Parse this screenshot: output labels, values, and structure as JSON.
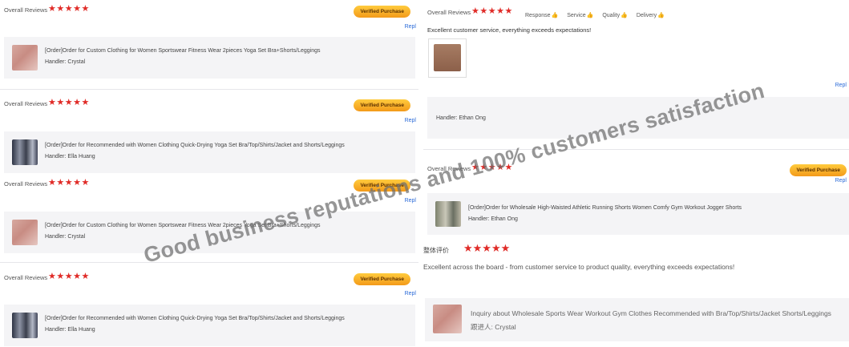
{
  "left_reviews": [
    {
      "label": "Overall Reviews",
      "stars": "★★★★★",
      "badge": "Verified Purchase",
      "reply": "Repl",
      "order_title": "[Order]Order for Custom Clothing for Women Sportswear Fitness Wear 2pieces Yoga Set Bra+Shorts/Leggings",
      "handler": "Handler: Crystal"
    },
    {
      "label": "Overall Reviews",
      "stars": "★★★★★",
      "badge": "Verified Purchase",
      "reply": "Repl",
      "order_title": "[Order]Order for Recommended with Women Clothing Quick-Drying Yoga Set Bra/Top/Shirts/Jacket and Shorts/Leggings",
      "handler": "Handler: Ella Huang"
    },
    {
      "label": "Overall Reviews",
      "stars": "★★★★★",
      "badge": "Verified Purchase",
      "reply": "Repl",
      "order_title": "[Order]Order for Custom Clothing for Women Sportswear Fitness Wear 2pieces Yoga Set Bra+Shorts/Leggings",
      "handler": "Handler: Crystal"
    },
    {
      "label": "Overall Reviews",
      "stars": "★★★★★",
      "badge": "Verified Purchase",
      "reply": "Repl",
      "order_title": "[Order]Order for Recommended with Women Clothing Quick-Drying Yoga Set Bra/Top/Shirts/Jacket and Shorts/Leggings",
      "handler": "Handler: Ella Huang"
    }
  ],
  "right_review1": {
    "label": "Overall Reviews",
    "stars": "★★★★★",
    "aspects": [
      "Response",
      "Service",
      "Quality",
      "Delivery"
    ],
    "text": "Excellent customer service, everything exceeds expectations!",
    "reply": "Repl",
    "handler": "Handler: Ethan Ong"
  },
  "right_review2": {
    "label": "Overall Reviews",
    "stars": "★★★★★",
    "badge": "Verified Purchase",
    "reply": "Repl",
    "order_title": "[Order]Order for Wholesale High-Waisted Athletic Running Shorts Women Comfy Gym Workout Jogger Shorts",
    "handler": "Handler: Ethan Ong"
  },
  "right_review3": {
    "label": "整体评价",
    "stars": "★★★★★",
    "text": "Excellent across the board - from customer service to product quality, everything exceeds expectations!",
    "inquiry_title": "Inquiry about Wholesale Sports Wear Workout Gym Clothes Recommended with Bra/Top/Shirts/Jacket Shorts/Leggings",
    "inquiry_handler": "跟进人: Crystal"
  },
  "watermark": "Good business reputations and 100% customers satisfaction",
  "colors": {
    "star": "#e02b27",
    "badge_start": "#ffcb3d",
    "badge_end": "#f39a1a",
    "reply": "#2b6bd8"
  },
  "icons": {
    "thumb": "thumbs-up-icon",
    "star": "star-icon"
  }
}
